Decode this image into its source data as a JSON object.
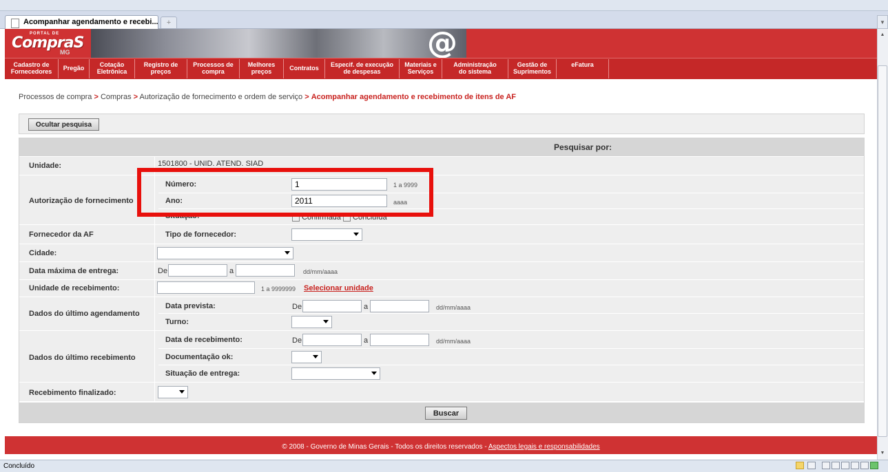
{
  "browser": {
    "tab_title": "Acompanhar agendamento e recebi...",
    "new_tab_label": "+",
    "status": "Concluído"
  },
  "header": {
    "logo_portal": "PORTAL DE",
    "logo_compras": "CompraS",
    "logo_mg": "MG",
    "at_logo": "@",
    "menu": [
      {
        "l1": "Cadastro de",
        "l2": "Fornecedores"
      },
      {
        "l1": "Pregão",
        "l2": ""
      },
      {
        "l1": "Cotação",
        "l2": "Eletrônica"
      },
      {
        "l1": "Registro de",
        "l2": "preços"
      },
      {
        "l1": "Processos de",
        "l2": "compra"
      },
      {
        "l1": "Melhores",
        "l2": "preços"
      },
      {
        "l1": "Contratos",
        "l2": ""
      },
      {
        "l1": "Especif. de execução",
        "l2": "de despesas"
      },
      {
        "l1": "Materiais e",
        "l2": "Serviços"
      },
      {
        "l1": "Administração",
        "l2": "do sistema"
      },
      {
        "l1": "Gestão de",
        "l2": "Suprimentos"
      },
      {
        "l1": "eFatura",
        "l2": ""
      }
    ]
  },
  "breadcrumb": {
    "items": [
      "Processos de compra",
      "Compras",
      "Autorização de fornecimento e ordem de serviço"
    ],
    "separator": ">",
    "current": "Acompanhar agendamento e recebimento de itens de AF"
  },
  "toolbar": {
    "hide_search": "Ocultar pesquisa"
  },
  "form": {
    "header": "Pesquisar por:",
    "unidade": {
      "label": "Unidade:",
      "value": "1501800 - UNID. ATEND. SIAD"
    },
    "autorizacao": {
      "label": "Autorização de fornecimento",
      "numero_label": "Número:",
      "numero_value": "1",
      "numero_hint": "1 a 9999",
      "ano_label": "Ano:",
      "ano_value": "2011",
      "ano_hint": "aaaa",
      "situacao_label": "Situação:",
      "situacao_opt1": "Confirmada",
      "situacao_opt2": "Concluída"
    },
    "fornecedor": {
      "label": "Fornecedor da AF",
      "tipo_label": "Tipo de fornecedor:",
      "tipo_value": ""
    },
    "cidade": {
      "label": "Cidade:",
      "value": ""
    },
    "data_maxima": {
      "label": "Data máxima de entrega:",
      "de": "De",
      "a": "a",
      "hint": "dd/mm/aaaa",
      "from_value": "",
      "to_value": ""
    },
    "unidade_recebimento": {
      "label": "Unidade de recebimento:",
      "value": "",
      "hint": "1 a 9999999",
      "link": "Selecionar unidade"
    },
    "ultimo_agendamento": {
      "label": "Dados do último agendamento",
      "data_prevista_label": "Data prevista:",
      "de": "De",
      "a": "a",
      "hint": "dd/mm/aaaa",
      "turno_label": "Turno:",
      "turno_value": ""
    },
    "ultimo_recebimento": {
      "label": "Dados do último recebimento",
      "data_recebimento_label": "Data de recebimento:",
      "de": "De",
      "a": "a",
      "hint": "dd/mm/aaaa",
      "documentacao_label": "Documentação ok:",
      "documentacao_value": "",
      "situacao_entrega_label": "Situação de entrega:",
      "situacao_entrega_value": ""
    },
    "recebimento_finalizado": {
      "label": "Recebimento finalizado:",
      "value": ""
    },
    "search_button": "Buscar"
  },
  "footer": {
    "text": "© 2008 - Governo de Minas Gerais - Todos os direitos reservados - ",
    "link": "Aspectos legais e responsabilidades"
  },
  "colors": {
    "brand_red": "#cf3233",
    "highlight_red": "#e8100c",
    "link_red": "#c8211e"
  }
}
